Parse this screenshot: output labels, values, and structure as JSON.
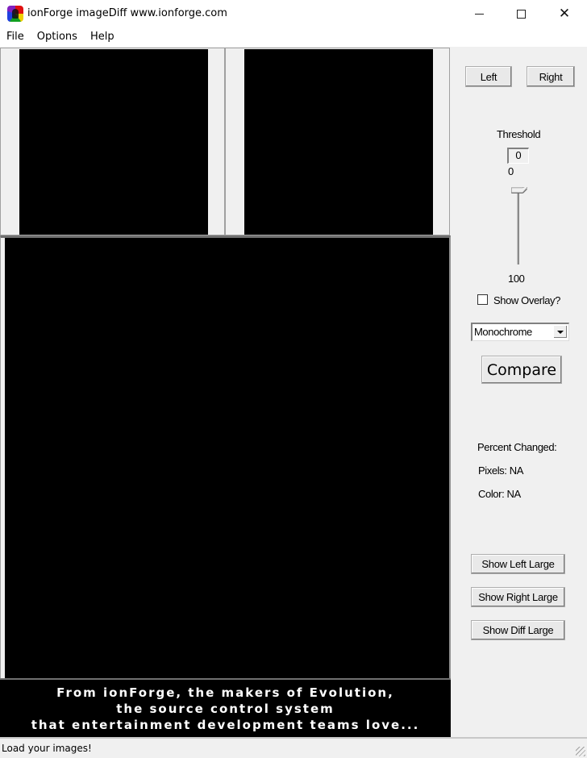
{
  "window": {
    "title": "ionForge imageDiff www.ionforge.com",
    "icon": "ionforge-app-icon",
    "controls": {
      "minimize": "minimize-icon",
      "maximize": "maximize-icon",
      "close": "close-icon",
      "close_glyph": "✕"
    }
  },
  "menu": {
    "items": [
      {
        "label": "File"
      },
      {
        "label": "Options"
      },
      {
        "label": "Help"
      }
    ]
  },
  "panes": {
    "left": "left-image-pane",
    "right": "right-image-pane",
    "diff": "diff-image-pane"
  },
  "banner": {
    "lines": [
      "From ionForge, the makers of Evolution,",
      "the source control system",
      "that entertainment development teams love..."
    ]
  },
  "side": {
    "left_button": "Left",
    "right_button": "Right",
    "threshold_label": "Threshold",
    "threshold_box_value": "0",
    "threshold_value": "0",
    "slider": {
      "min": "0",
      "max": "100",
      "value": 0
    },
    "overlay_label": "Show Overlay?",
    "overlay_checked": false,
    "mode_select": {
      "value": "Monochrome"
    },
    "compare_button": "Compare",
    "percent_changed_label": "Percent Changed:",
    "pixels_label": "Pixels: NA",
    "color_label": "Color: NA",
    "show_left_large": "Show Left Large",
    "show_right_large": "Show Right Large",
    "show_diff_large": "Show Diff Large"
  },
  "status": {
    "text": "Load your images!"
  }
}
